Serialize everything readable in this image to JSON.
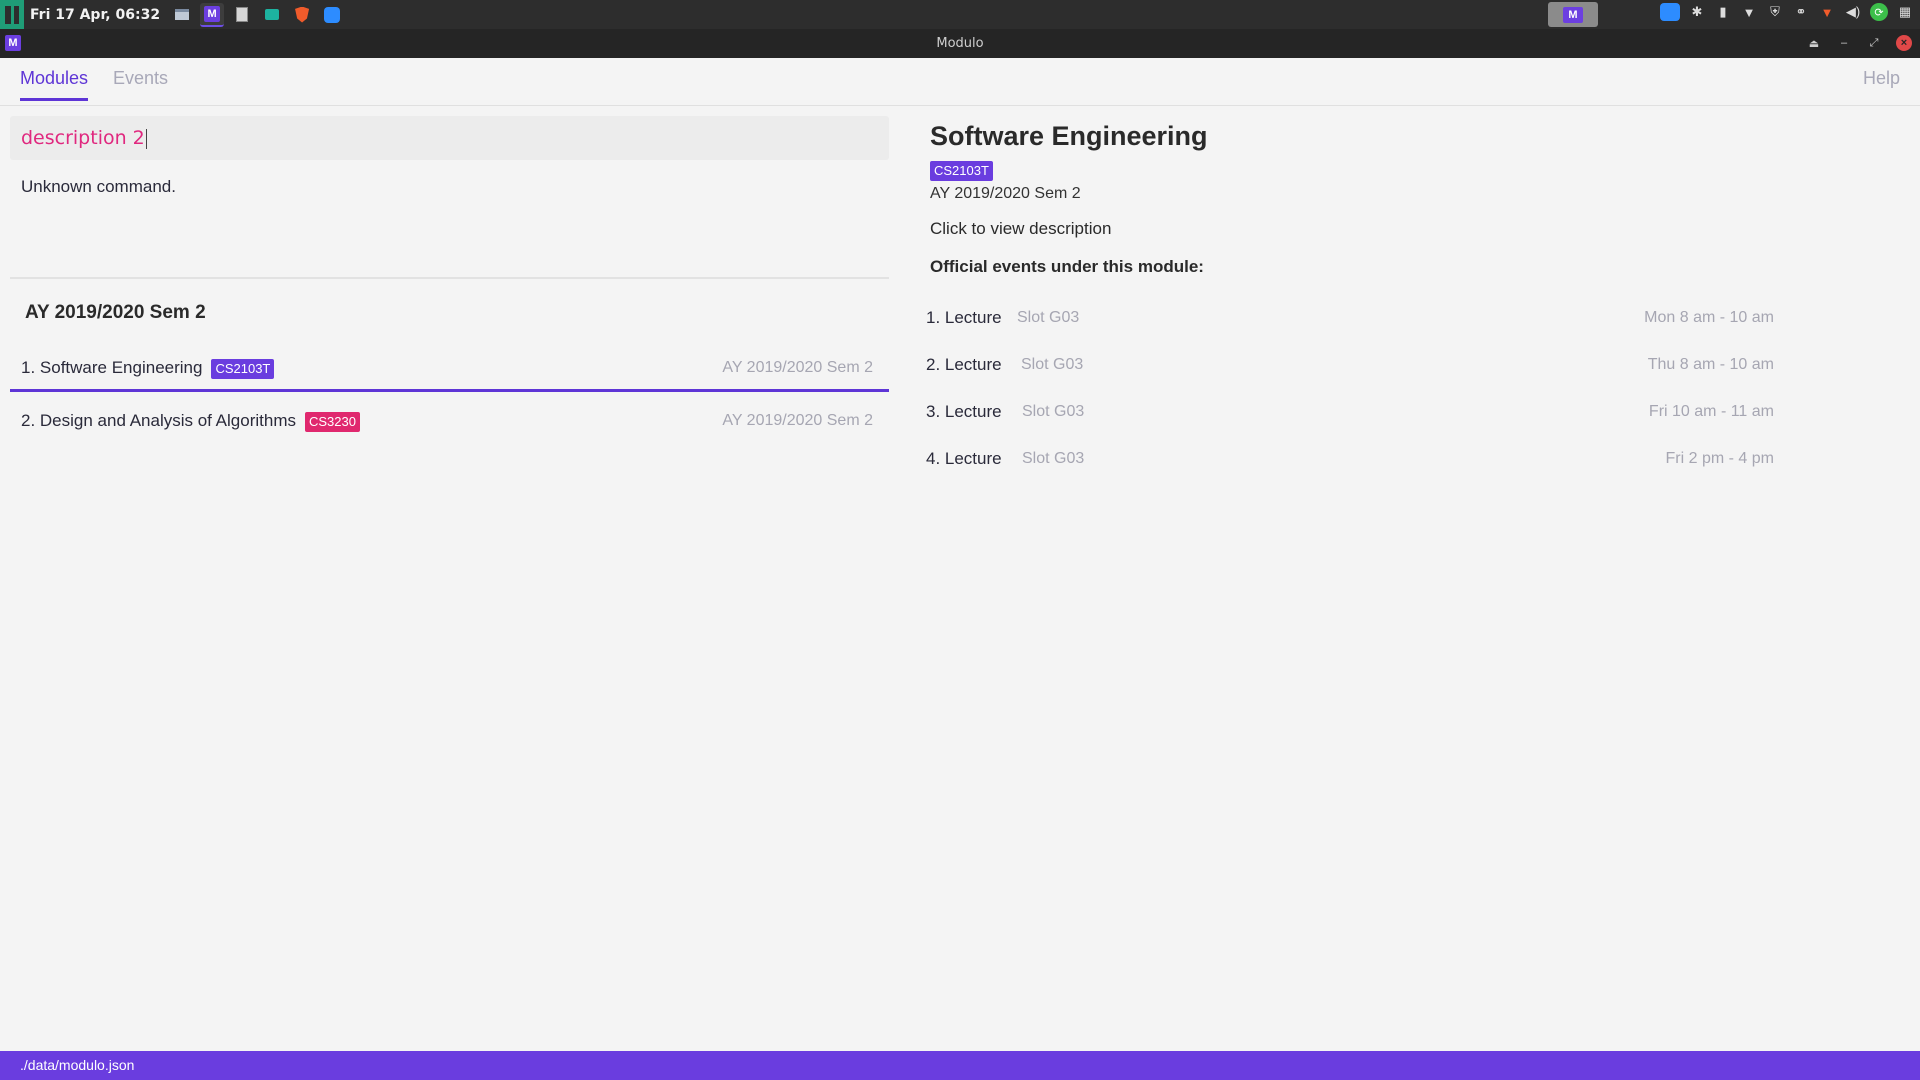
{
  "panel": {
    "clock": "Fri 17 Apr, 06:32",
    "tasks": [
      "files-icon",
      "modulo-icon",
      "document-icon",
      "mail-icon",
      "brave-icon",
      "zoom-icon"
    ],
    "modulo_letter": "M"
  },
  "window": {
    "title": "Modulo",
    "app_letter": "M"
  },
  "tabs": {
    "modules": "Modules",
    "events": "Events",
    "help": "Help"
  },
  "command": {
    "input": "description 2",
    "result": "Unknown command."
  },
  "module_list": {
    "heading": "AY 2019/2020 Sem 2",
    "items": [
      {
        "label": "1. Software Engineering",
        "code": "CS2103T",
        "semester": "AY 2019/2020 Sem 2",
        "tag_color": "#6a3ddf"
      },
      {
        "label": "2. Design and Analysis of Algorithms",
        "code": "CS3230",
        "semester": "AY 2019/2020 Sem 2",
        "tag_color": "#e0286e"
      }
    ]
  },
  "detail": {
    "title": "Software Engineering",
    "code": "CS2103T",
    "semester": "AY 2019/2020 Sem 2",
    "description_link": "Click to view description",
    "events_heading": "Official events under this module:",
    "events": [
      {
        "name": "1. Lecture",
        "slot": "Slot G03",
        "time": "Mon 8 am - 10 am"
      },
      {
        "name": "2. Lecture",
        "slot": "Slot G03",
        "time": "Thu 8 am - 10 am"
      },
      {
        "name": "3. Lecture",
        "slot": "Slot G03",
        "time": "Fri 10 am - 11 am"
      },
      {
        "name": "4. Lecture",
        "slot": "Slot G03",
        "time": "Fri 2 pm - 4 pm"
      }
    ]
  },
  "status": {
    "path": "./data/modulo.json"
  },
  "colors": {
    "accent": "#6a3ddf",
    "pink": "#e0286e",
    "muted": "#a6a6b2"
  }
}
